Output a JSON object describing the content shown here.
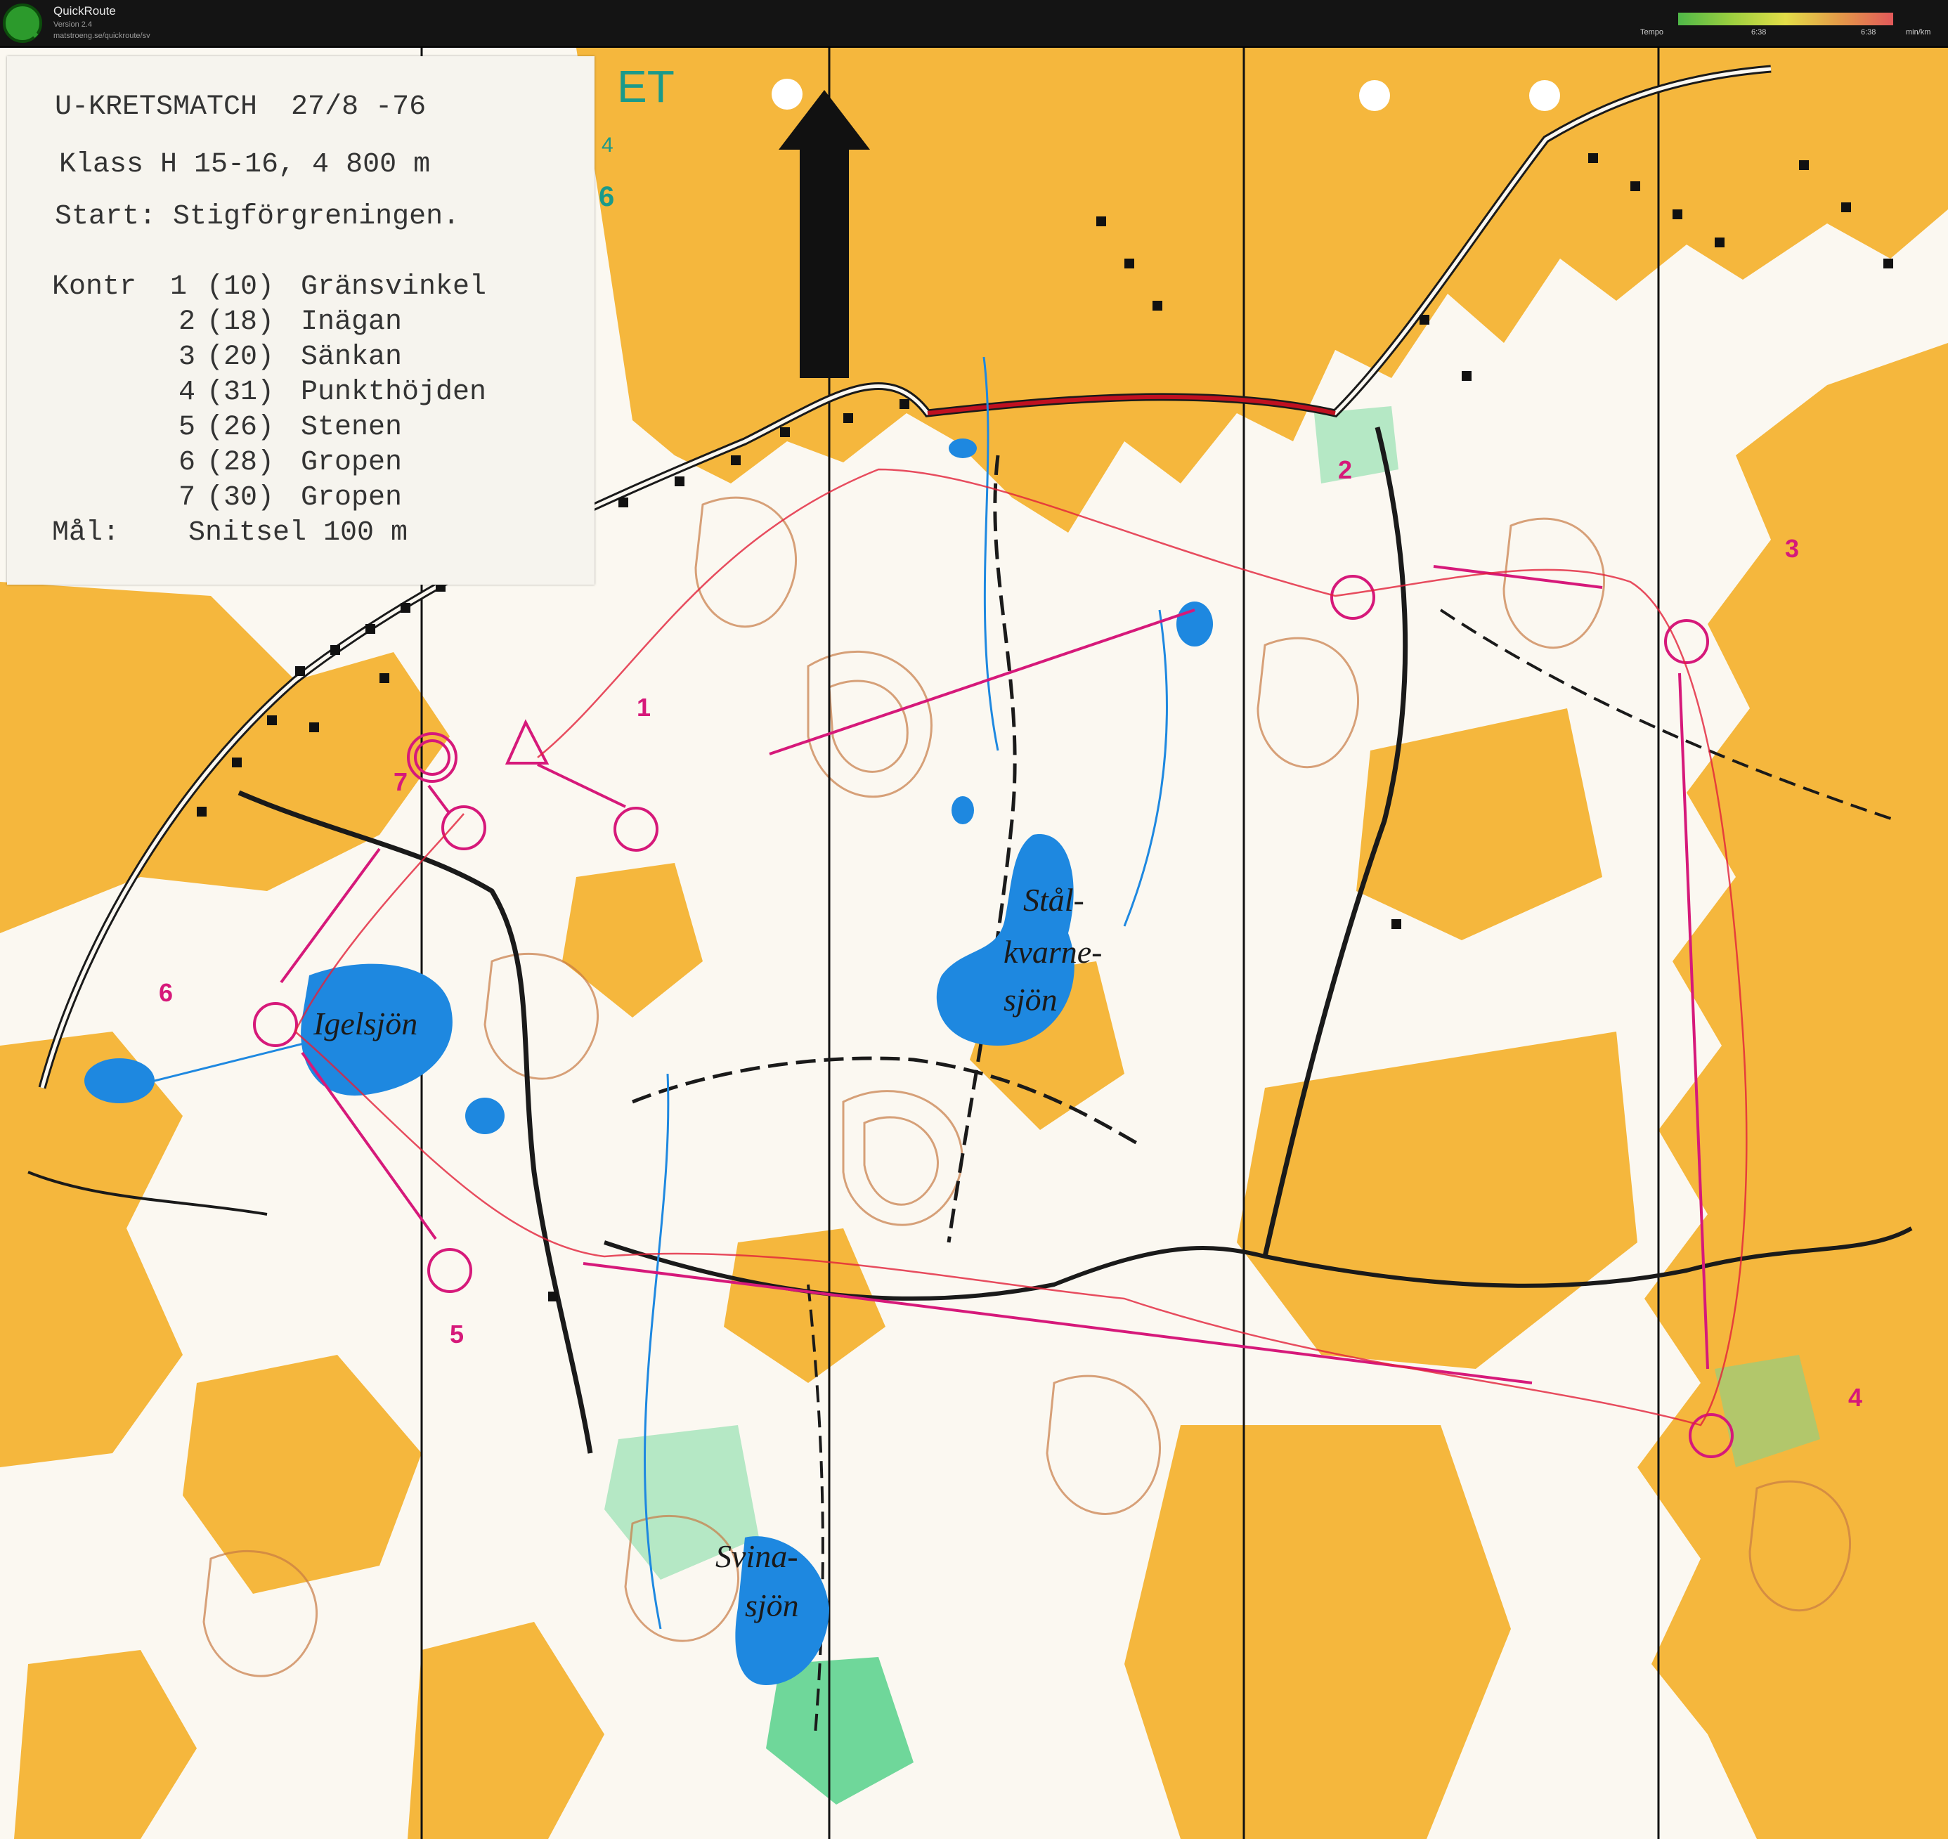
{
  "app": {
    "name": "QuickRoute",
    "version": "Version 2.4",
    "url": "matstroeng.se/quickroute/sv",
    "logo_glyph": "Q"
  },
  "tempo_legend": {
    "label": "Tempo",
    "min_value": "6:38",
    "max_value": "6:38",
    "unit": "min/km",
    "colors": [
      "#4fb848",
      "#9ccf3f",
      "#e3dd48",
      "#e49a48",
      "#e2595a"
    ]
  },
  "course_card": {
    "event": "U-KRETSMATCH  27/8 -76",
    "class_line": "Klass H 15-16, 4 800 m",
    "start_line": "Start: Stigförgreningen.",
    "controls_header": "Kontr",
    "controls": [
      {
        "no": "1",
        "code": "(10)",
        "description": "Gränsvinkel"
      },
      {
        "no": "2",
        "code": "(18)",
        "description": "Inägan"
      },
      {
        "no": "3",
        "code": "(20)",
        "description": "Sänkan"
      },
      {
        "no": "4",
        "code": "(31)",
        "description": "Punkthöjden"
      },
      {
        "no": "5",
        "code": "(26)",
        "description": "Stenen"
      },
      {
        "no": "6",
        "code": "(28)",
        "description": "Gropen"
      },
      {
        "no": "7",
        "code": "(30)",
        "description": "Gropen"
      }
    ],
    "finish_label": "Mål:",
    "finish_value": "Snitsel 100 m"
  },
  "map_labels": {
    "lake_1": "Igelsjön",
    "lake_2": [
      "Stål-",
      "kvarne-",
      "sjön"
    ],
    "lake_3": [
      "Svina-",
      "sjön"
    ],
    "edge_fragment": "ET",
    "edge_digit_1": "4",
    "edge_digit_2": "6"
  },
  "control_numbers": [
    "1",
    "2",
    "3",
    "4",
    "5",
    "6",
    "7"
  ],
  "colors": {
    "open_land": "#f5b73d",
    "forest": "#fbf8f1",
    "water": "#1e88e0",
    "green": "#6fd79a",
    "course": "#d6197a",
    "route": "#e2203a",
    "contour": "#c77b45",
    "track": "#1a1a1a"
  }
}
